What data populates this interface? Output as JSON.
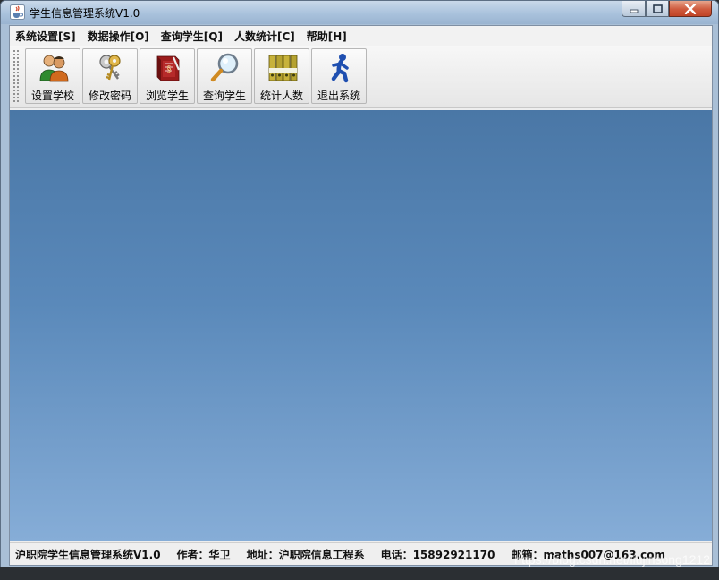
{
  "window": {
    "title": "学生信息管理系统V1.0",
    "icon": "java-cup-icon",
    "controls": {
      "minimize_icon": "minimize-icon",
      "maximize_icon": "maximize-icon",
      "close_icon": "close-icon"
    }
  },
  "menubar": {
    "items": [
      {
        "label": "系统设置[S]"
      },
      {
        "label": "数据操作[O]"
      },
      {
        "label": "查询学生[Q]"
      },
      {
        "label": "人数统计[C]"
      },
      {
        "label": "帮助[H]"
      }
    ]
  },
  "toolbar": {
    "buttons": [
      {
        "label": "设置学校",
        "icon": "users-icon"
      },
      {
        "label": "修改密码",
        "icon": "keys-icon"
      },
      {
        "label": "浏览学生",
        "icon": "book-icon"
      },
      {
        "label": "查询学生",
        "icon": "magnifier-icon"
      },
      {
        "label": "统计人数",
        "icon": "binders-icon"
      },
      {
        "label": "退出系统",
        "icon": "running-man-icon"
      }
    ]
  },
  "statusbar": {
    "items": [
      {
        "text": "沪职院学生信息管理系统V1.0"
      },
      {
        "text": "作者：华卫"
      },
      {
        "text": "地址：沪职院信息工程系"
      },
      {
        "text": "电话：15892921170"
      },
      {
        "text": "邮箱：maths007@163.com"
      }
    ]
  },
  "watermark": "https://blog.csdn.net/liujinsong1212",
  "colors": {
    "desktop_top": "#4a77a6",
    "desktop_bottom": "#86add7",
    "titlebar": "#a9c2dc",
    "close_button": "#cf5a3d"
  }
}
